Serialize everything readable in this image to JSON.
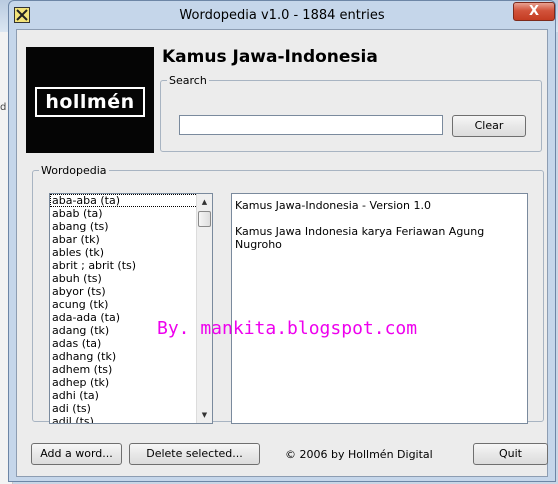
{
  "window": {
    "title": "Wordopedia v1.0 - 1884 entries",
    "close_glyph": "X"
  },
  "background": {
    "left_fragment": "d"
  },
  "header": {
    "logo_text": "hollmén",
    "title": "Kamus Jawa-Indonesia"
  },
  "search": {
    "group_label": "Search",
    "value": "",
    "placeholder": "",
    "clear_label": "Clear"
  },
  "main": {
    "group_label": "Wordopedia",
    "words": [
      "aba-aba (ta)",
      "abab (ta)",
      "abang (ts)",
      "abar (tk)",
      "ables (tk)",
      "abrit ; abrit (ts)",
      "abuh (ts)",
      "abyor (ts)",
      "acung (tk)",
      "ada-ada (ta)",
      "adang (tk)",
      "adas (ta)",
      "adhang (tk)",
      "adhem (ts)",
      "adhep (tk)",
      "adhi (ta)",
      "adi (ts)",
      "adil (ts)"
    ],
    "selected_index": 0,
    "description": "Kamus Jawa-Indonesia - Version 1.0\n\nKamus Jawa Indonesia karya Feriawan Agung\nNugroho"
  },
  "watermark": "By. mankita.blogspot.com",
  "footer": {
    "add_label": "Add a word...",
    "delete_label": "Delete selected...",
    "copyright": "© 2006 by Hollmén Digital",
    "quit_label": "Quit"
  },
  "colors": {
    "watermark": "#ee00ee",
    "close_button": "#c43c22",
    "logo_bg": "#050505"
  }
}
